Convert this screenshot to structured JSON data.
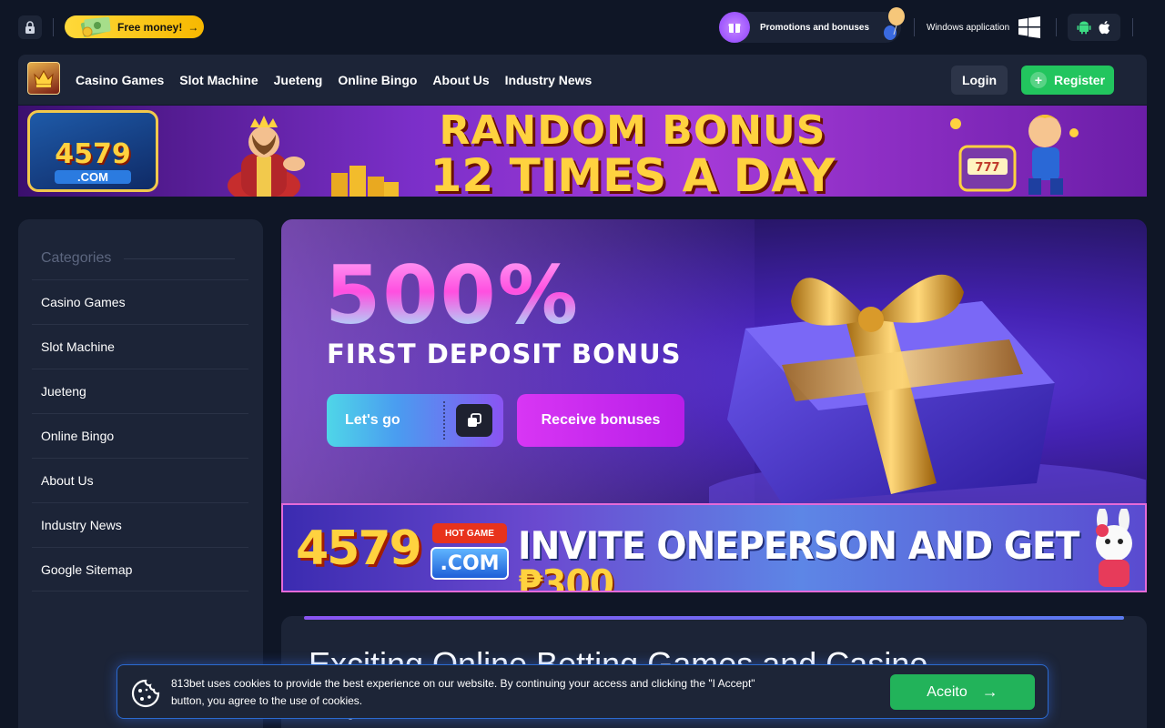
{
  "topbar": {
    "free_money": "Free money!",
    "free_money_arrow": "→",
    "promotions": "Promotions and bonuses",
    "windows_app": "Windows application"
  },
  "nav": {
    "logo_text": "",
    "links": [
      "Casino Games",
      "Slot Machine",
      "Jueteng",
      "Online Bingo",
      "About Us",
      "Industry News"
    ],
    "login": "Login",
    "register": "Register",
    "register_plus": "+"
  },
  "top_banner": {
    "logo_text": "4579",
    "logo_sub": ".COM",
    "line1": "RANDOM BONUS",
    "line2": "12 TIMES A DAY"
  },
  "sidebar": {
    "title": "Categories",
    "items": [
      "Casino Games",
      "Slot Machine",
      "Jueteng",
      "Online Bingo",
      "About Us",
      "Industry News",
      "Google Sitemap"
    ]
  },
  "hero": {
    "percent": "500%",
    "subtitle": "FIRST DEPOSIT BONUS",
    "lets_go": "Let's go",
    "receive": "Receive bonuses"
  },
  "invite": {
    "logo_num": "4579",
    "hot": "HOT GAME",
    "com": ".COM",
    "text": "INVITE ONEPERSON AND GET ",
    "amount": "₱300"
  },
  "article": {
    "title": "Exciting Online Betting Games and Casino Experiences for Enthusiasts"
  },
  "cookie": {
    "text": "813bet uses cookies to provide the best experience on our website. By continuing your access and clicking the \"I Accept\" button, you agree to the use of cookies.",
    "accept": "Aceito",
    "accept_arrow": "→"
  },
  "colors": {
    "background": "#0f1626",
    "panel": "#1c2437",
    "register_green": "#22c55e",
    "accept_green": "#22b35a",
    "free_money_yellow": "#ffd93a",
    "receive_magenta": "#d836f4"
  },
  "icons": [
    "lock-icon",
    "cash-icon",
    "gift-icon",
    "balloon-icon",
    "windows-icon",
    "android-icon",
    "apple-icon",
    "copy-icon",
    "cookie-icon",
    "arrow-right-icon"
  ]
}
